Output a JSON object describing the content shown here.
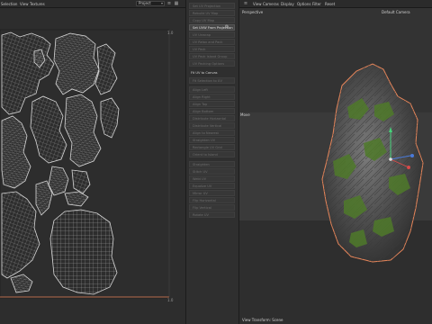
{
  "menubar": {
    "items": [
      "Selection",
      "View",
      "Textures"
    ],
    "project_select": "Project",
    "viewport_menu": [
      "View",
      "Cameras",
      "Display",
      "Options",
      "Filter",
      "Reset"
    ]
  },
  "uv_editor": {
    "axis_top": "1.0",
    "axis_bottom": "1.0"
  },
  "tool_panel": {
    "items": [
      {
        "label": "Set UV Projection",
        "active": false
      },
      {
        "label": "Rebuild UV Map",
        "active": false
      },
      {
        "label": "Copy UV Map",
        "active": false
      },
      {
        "label": "Set UVW From Projection",
        "active": true
      },
      {
        "label": "UV Unwrap",
        "active": false
      },
      {
        "label": "UV Relax and Pack",
        "active": false
      },
      {
        "label": "UV Pack",
        "active": false
      },
      {
        "label": "UV Pack Island Group",
        "active": false
      },
      {
        "label": "UV Packing Options",
        "active": false
      }
    ],
    "section_title": "Fit UV to Canvas",
    "section_sub": "Fit Selection to UV",
    "items2": [
      "Align Left",
      "Align Right",
      "Align Top",
      "Align Bottom",
      "Distribute Horizontal",
      "Distribute Vertical",
      "Align to Nearest",
      "Straighten UV",
      "Rectangle UV Grid",
      "Orient to Island"
    ],
    "items3": [
      "Straighten",
      "Stitch UV",
      "Weld UV",
      "Equalize UV",
      "Mirror UV",
      "Flip Horizontal",
      "Flip Vertical",
      "Rotate UV"
    ]
  },
  "viewport": {
    "title": "Perspective",
    "camera": "Default Camera",
    "side_label": "Move",
    "status": "View Transform: Scene"
  },
  "colors": {
    "accent": "#e8865a",
    "gizmo_green": "#46d17a",
    "gizmo_red": "#d94a4a",
    "gizmo_blue": "#4a7ad9"
  },
  "icons": {
    "gear": "gear-icon",
    "dropdown": "chevron-down-icon"
  }
}
